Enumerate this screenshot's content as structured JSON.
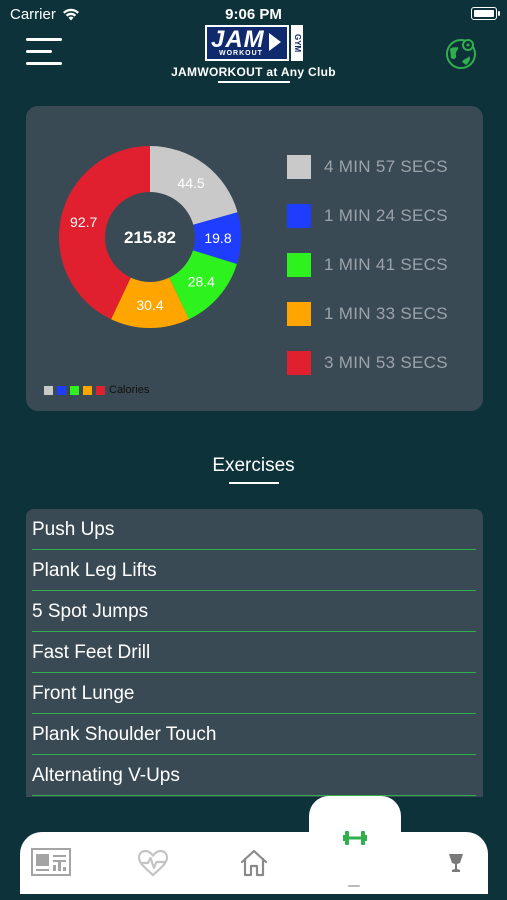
{
  "status_bar": {
    "carrier": "Carrier",
    "time": "9:06 PM"
  },
  "header": {
    "logo": {
      "main": "JAM",
      "sub": "WORKOUT",
      "side": "GYM"
    },
    "club_title": "JAMWORKOUT at Any Club"
  },
  "chart_data": {
    "type": "pie",
    "center_total": "215.82",
    "slices": [
      {
        "label": "4 MIN 57 SECS",
        "value": 44.5,
        "color": "#c9c9c9"
      },
      {
        "label": "1 MIN 24 SECS",
        "value": 19.8,
        "color": "#1f3dff"
      },
      {
        "label": "1 MIN 41 SECS",
        "value": 28.4,
        "color": "#2ef21e"
      },
      {
        "label": "1 MIN 33 SECS",
        "value": 30.4,
        "color": "#ffa500"
      },
      {
        "label": "3 MIN 53 SECS",
        "value": 92.7,
        "color": "#e0202e"
      }
    ],
    "legend_caption": "Calories"
  },
  "exercises": {
    "title": "Exercises",
    "items": [
      "Push Ups",
      "Plank Leg Lifts",
      "5 Spot Jumps",
      "Fast Feet Drill",
      "Front Lunge",
      "Plank Shoulder Touch",
      "Alternating V-Ups"
    ]
  },
  "tabs": [
    {
      "name": "tab-news",
      "icon": "news-icon"
    },
    {
      "name": "tab-health",
      "icon": "heart-rate-icon"
    },
    {
      "name": "tab-home",
      "icon": "home-icon"
    },
    {
      "name": "tab-workout",
      "icon": "dumbbell-icon",
      "active": true
    },
    {
      "name": "tab-trophy",
      "icon": "trophy-icon"
    }
  ],
  "colors": {
    "background": "#0d3239",
    "card": "#3a4a54",
    "accent": "#2fb04d"
  }
}
